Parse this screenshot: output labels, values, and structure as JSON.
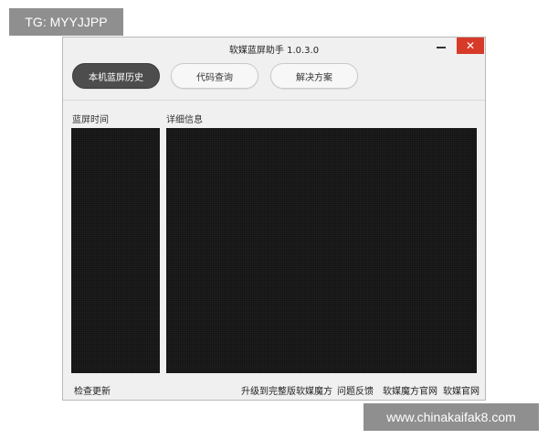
{
  "watermarks": {
    "top_left": "TG: MYYJJPP",
    "bottom_right": "www.chinakaifak8.com"
  },
  "window": {
    "title": "软媒蓝屏助手 1.0.3.0",
    "minimize_icon": "minimize-icon",
    "close_icon": "close-icon",
    "close_glyph": "✕",
    "close_color": "#d83a2a"
  },
  "tabs": [
    {
      "label": "本机蓝屏历史",
      "active": true
    },
    {
      "label": "代码查询",
      "active": false
    },
    {
      "label": "解决方案",
      "active": false
    }
  ],
  "panels": {
    "left_label": "蓝屏时间",
    "right_label": "详细信息"
  },
  "footer": {
    "check_update": "检查更新",
    "links": [
      "升级到完整版软媒魔方",
      "问题反馈",
      "软媒魔方官网",
      "软媒官网"
    ]
  },
  "colors": {
    "active_tab": "#4d4d4d",
    "panel_bg": "#121212"
  }
}
